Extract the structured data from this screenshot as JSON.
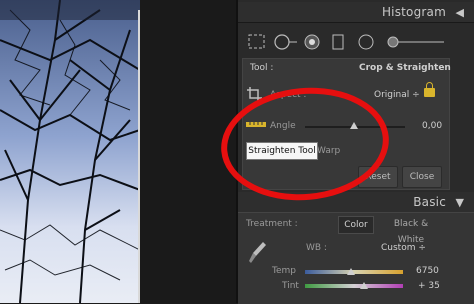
{
  "histogram": {
    "title": "Histogram"
  },
  "crop": {
    "tool_label": "Tool :",
    "tool_value": "Crop & Straighten",
    "aspect_label": "Aspect :",
    "aspect_value": "Original ÷",
    "angle_label": "Angle",
    "angle_value": "0,00",
    "tooltip": "Straighten Tool",
    "warp_fragment": "Warp",
    "reset_label": "Reset",
    "close_label": "Close"
  },
  "basic": {
    "title": "Basic",
    "treatment_label": "Treatment :",
    "color_label": "Color",
    "bw_label": "Black & White",
    "wb_label": "WB :",
    "wb_value": "Custom ÷",
    "temp_label": "Temp",
    "temp_value": "6750",
    "tint_label": "Tint",
    "tint_value": "+ 35"
  },
  "colors": {
    "annotation_red": "#e60f0f",
    "lock_gold": "#d9b52c"
  }
}
